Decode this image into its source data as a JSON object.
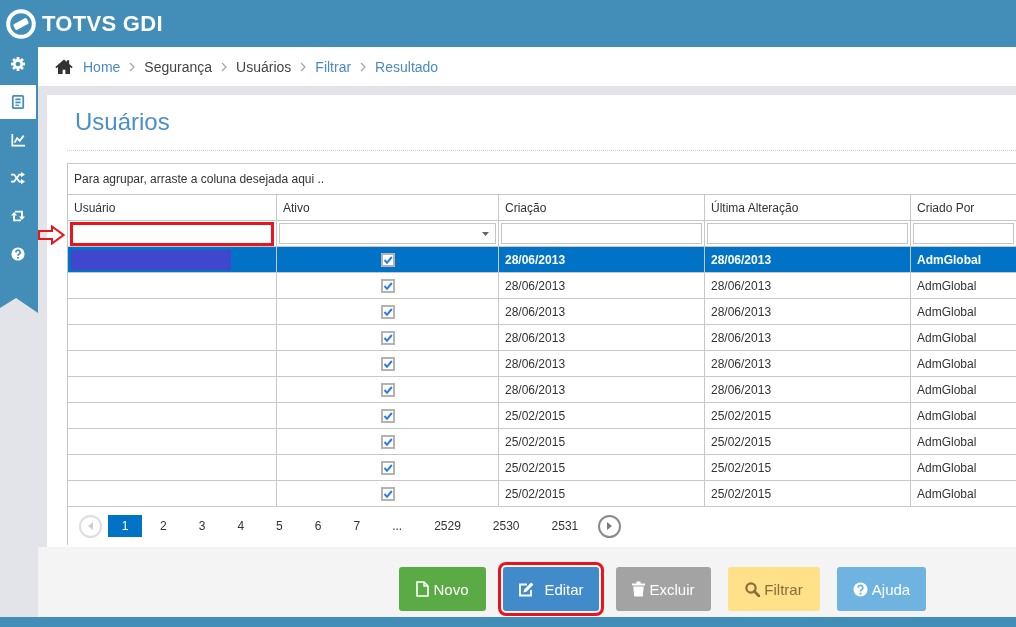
{
  "header": {
    "logo_text": "TOTVS GDI"
  },
  "sidebar": {
    "items": [
      {
        "kind": "gear",
        "selected": false
      },
      {
        "kind": "document",
        "selected": true
      },
      {
        "kind": "chart",
        "selected": false
      },
      {
        "kind": "shuffle",
        "selected": false
      },
      {
        "kind": "repeat",
        "selected": false
      },
      {
        "kind": "help",
        "selected": false
      }
    ]
  },
  "breadcrumb": [
    {
      "label": "Home",
      "link": true
    },
    {
      "label": "Segurança",
      "link": false
    },
    {
      "label": "Usuários",
      "link": false
    },
    {
      "label": "Filtrar",
      "link": true
    },
    {
      "label": "Resultado",
      "link": true
    }
  ],
  "page_title": "Usuários",
  "grid": {
    "group_hint": "Para agrupar, arraste a coluna desejada aqui ..",
    "columns": [
      "Usuário",
      "Ativo",
      "Criação",
      "Última Alteração",
      "Criado Por"
    ],
    "filters": [
      {
        "kind": "text",
        "highlighted": true,
        "arrow": true
      },
      {
        "kind": "select",
        "highlighted": false,
        "arrow": false
      },
      {
        "kind": "text",
        "highlighted": false,
        "arrow": false
      },
      {
        "kind": "text",
        "highlighted": false,
        "arrow": false
      },
      {
        "kind": "text",
        "highlighted": false,
        "arrow": false
      }
    ],
    "rows": [
      {
        "selected": true,
        "redacted": true,
        "active": true,
        "created": "28/06/2013",
        "modified": "28/06/2013",
        "created_by": "AdmGlobal"
      },
      {
        "selected": false,
        "redacted": false,
        "active": true,
        "created": "28/06/2013",
        "modified": "28/06/2013",
        "created_by": "AdmGlobal"
      },
      {
        "selected": false,
        "redacted": false,
        "active": true,
        "created": "28/06/2013",
        "modified": "28/06/2013",
        "created_by": "AdmGlobal"
      },
      {
        "selected": false,
        "redacted": false,
        "active": true,
        "created": "28/06/2013",
        "modified": "28/06/2013",
        "created_by": "AdmGlobal"
      },
      {
        "selected": false,
        "redacted": false,
        "active": true,
        "created": "28/06/2013",
        "modified": "28/06/2013",
        "created_by": "AdmGlobal"
      },
      {
        "selected": false,
        "redacted": false,
        "active": true,
        "created": "28/06/2013",
        "modified": "28/06/2013",
        "created_by": "AdmGlobal"
      },
      {
        "selected": false,
        "redacted": false,
        "active": true,
        "created": "25/02/2015",
        "modified": "25/02/2015",
        "created_by": "AdmGlobal"
      },
      {
        "selected": false,
        "redacted": false,
        "active": true,
        "created": "25/02/2015",
        "modified": "25/02/2015",
        "created_by": "AdmGlobal"
      },
      {
        "selected": false,
        "redacted": false,
        "active": true,
        "created": "25/02/2015",
        "modified": "25/02/2015",
        "created_by": "AdmGlobal"
      },
      {
        "selected": false,
        "redacted": false,
        "active": true,
        "created": "25/02/2015",
        "modified": "25/02/2015",
        "created_by": "AdmGlobal"
      }
    ]
  },
  "pager": {
    "prev_disabled": true,
    "next_disabled": false,
    "pages": [
      {
        "label": "1",
        "selected": true
      },
      {
        "label": "2",
        "selected": false
      },
      {
        "label": "3",
        "selected": false
      },
      {
        "label": "4",
        "selected": false
      },
      {
        "label": "5",
        "selected": false
      },
      {
        "label": "6",
        "selected": false
      },
      {
        "label": "7",
        "selected": false
      },
      {
        "label": "...",
        "selected": false
      },
      {
        "label": "2529",
        "selected": false
      },
      {
        "label": "2530",
        "selected": false
      },
      {
        "label": "2531",
        "selected": false
      }
    ]
  },
  "actions": [
    {
      "kind": "new",
      "label": "Novo",
      "highlighted": false
    },
    {
      "kind": "edit",
      "label": "Editar",
      "highlighted": true
    },
    {
      "kind": "delete",
      "label": "Excluir",
      "highlighted": false
    },
    {
      "kind": "filter",
      "label": "Filtrar",
      "highlighted": false
    },
    {
      "kind": "help",
      "label": "Ajuda",
      "highlighted": false
    }
  ]
}
